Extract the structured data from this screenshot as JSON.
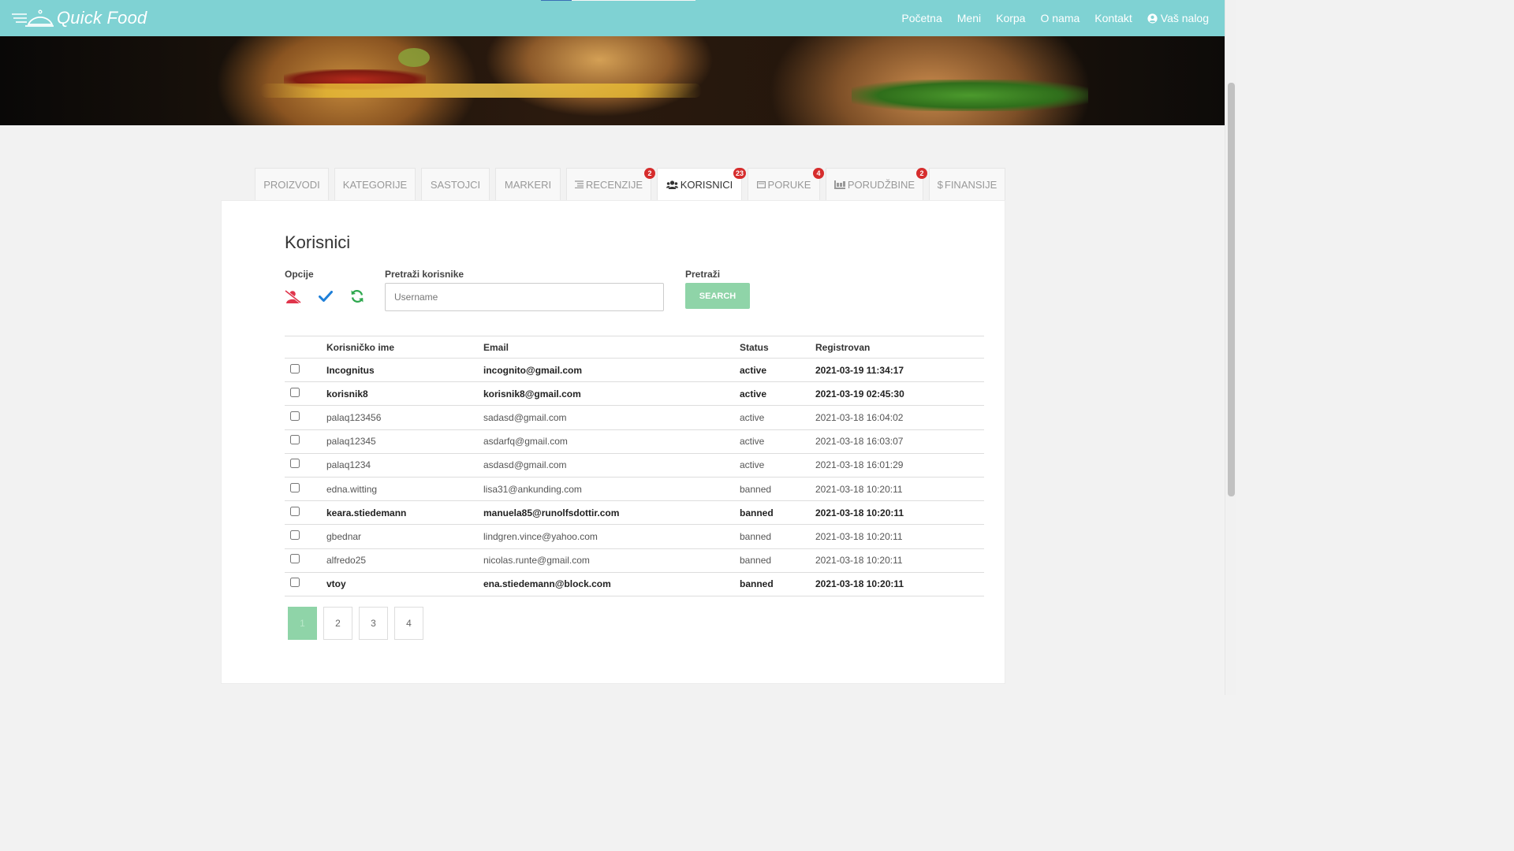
{
  "nav": {
    "brand": "Quick Food",
    "links": [
      "Početna",
      "Meni",
      "Korpa",
      "O nama",
      "Kontakt"
    ],
    "account": "Vaš nalog"
  },
  "tabs": [
    {
      "label": "PROIZVODI",
      "icon": "",
      "badge": null
    },
    {
      "label": "KATEGORIJE",
      "icon": "",
      "badge": null
    },
    {
      "label": "SASTOJCI",
      "icon": "",
      "badge": null
    },
    {
      "label": "MARKERI",
      "icon": "",
      "badge": null
    },
    {
      "label": "RECENZIJE",
      "icon": "list-icon",
      "badge": "2"
    },
    {
      "label": "KORISNICI",
      "icon": "users-icon",
      "badge": "23",
      "active": true
    },
    {
      "label": "PORUKE",
      "icon": "envelope-icon",
      "badge": "4"
    },
    {
      "label": "PORUDŽBINE",
      "icon": "truck-icon",
      "badge": "2"
    },
    {
      "label": "FINANSIJE",
      "icon": "dollar-icon",
      "badge": null
    }
  ],
  "panel": {
    "title": "Korisnici",
    "options_label": "Opcije",
    "search_label": "Pretraži korisnike",
    "search_placeholder": "Username",
    "search_button_label": "Pretraži",
    "search_button": "SEARCH"
  },
  "table": {
    "headers": [
      "Korisničko ime",
      "Email",
      "Status",
      "Registrovan"
    ],
    "rows": [
      {
        "username": "Incognitus",
        "email": "incognito@gmail.com",
        "status": "active",
        "registered": "2021-03-19 11:34:17",
        "bold": true
      },
      {
        "username": "korisnik8",
        "email": "korisnik8@gmail.com",
        "status": "active",
        "registered": "2021-03-19 02:45:30",
        "bold": true
      },
      {
        "username": "palaq123456",
        "email": "sadasd@gmail.com",
        "status": "active",
        "registered": "2021-03-18 16:04:02",
        "bold": false
      },
      {
        "username": "palaq12345",
        "email": "asdarfq@gmail.com",
        "status": "active",
        "registered": "2021-03-18 16:03:07",
        "bold": false
      },
      {
        "username": "palaq1234",
        "email": "asdasd@gmail.com",
        "status": "active",
        "registered": "2021-03-18 16:01:29",
        "bold": false
      },
      {
        "username": "edna.witting",
        "email": "lisa31@ankunding.com",
        "status": "banned",
        "registered": "2021-03-18 10:20:11",
        "bold": false
      },
      {
        "username": "keara.stiedemann",
        "email": "manuela85@runolfsdottir.com",
        "status": "banned",
        "registered": "2021-03-18 10:20:11",
        "bold": true
      },
      {
        "username": "gbednar",
        "email": "lindgren.vince@yahoo.com",
        "status": "banned",
        "registered": "2021-03-18 10:20:11",
        "bold": false
      },
      {
        "username": "alfredo25",
        "email": "nicolas.runte@gmail.com",
        "status": "banned",
        "registered": "2021-03-18 10:20:11",
        "bold": false
      },
      {
        "username": "vtoy",
        "email": "ena.stiedemann@block.com",
        "status": "banned",
        "registered": "2021-03-18 10:20:11",
        "bold": true
      }
    ]
  },
  "pagination": {
    "pages": [
      "1",
      "2",
      "3",
      "4"
    ],
    "current": "1"
  },
  "colors": {
    "navbar": "#7fd2d3",
    "accent_green": "#8fd4a8",
    "badge_red": "#d62d2d",
    "ban_icon": "#e0344b",
    "check_icon": "#1e7fd8",
    "refresh_icon": "#2fa84f"
  }
}
